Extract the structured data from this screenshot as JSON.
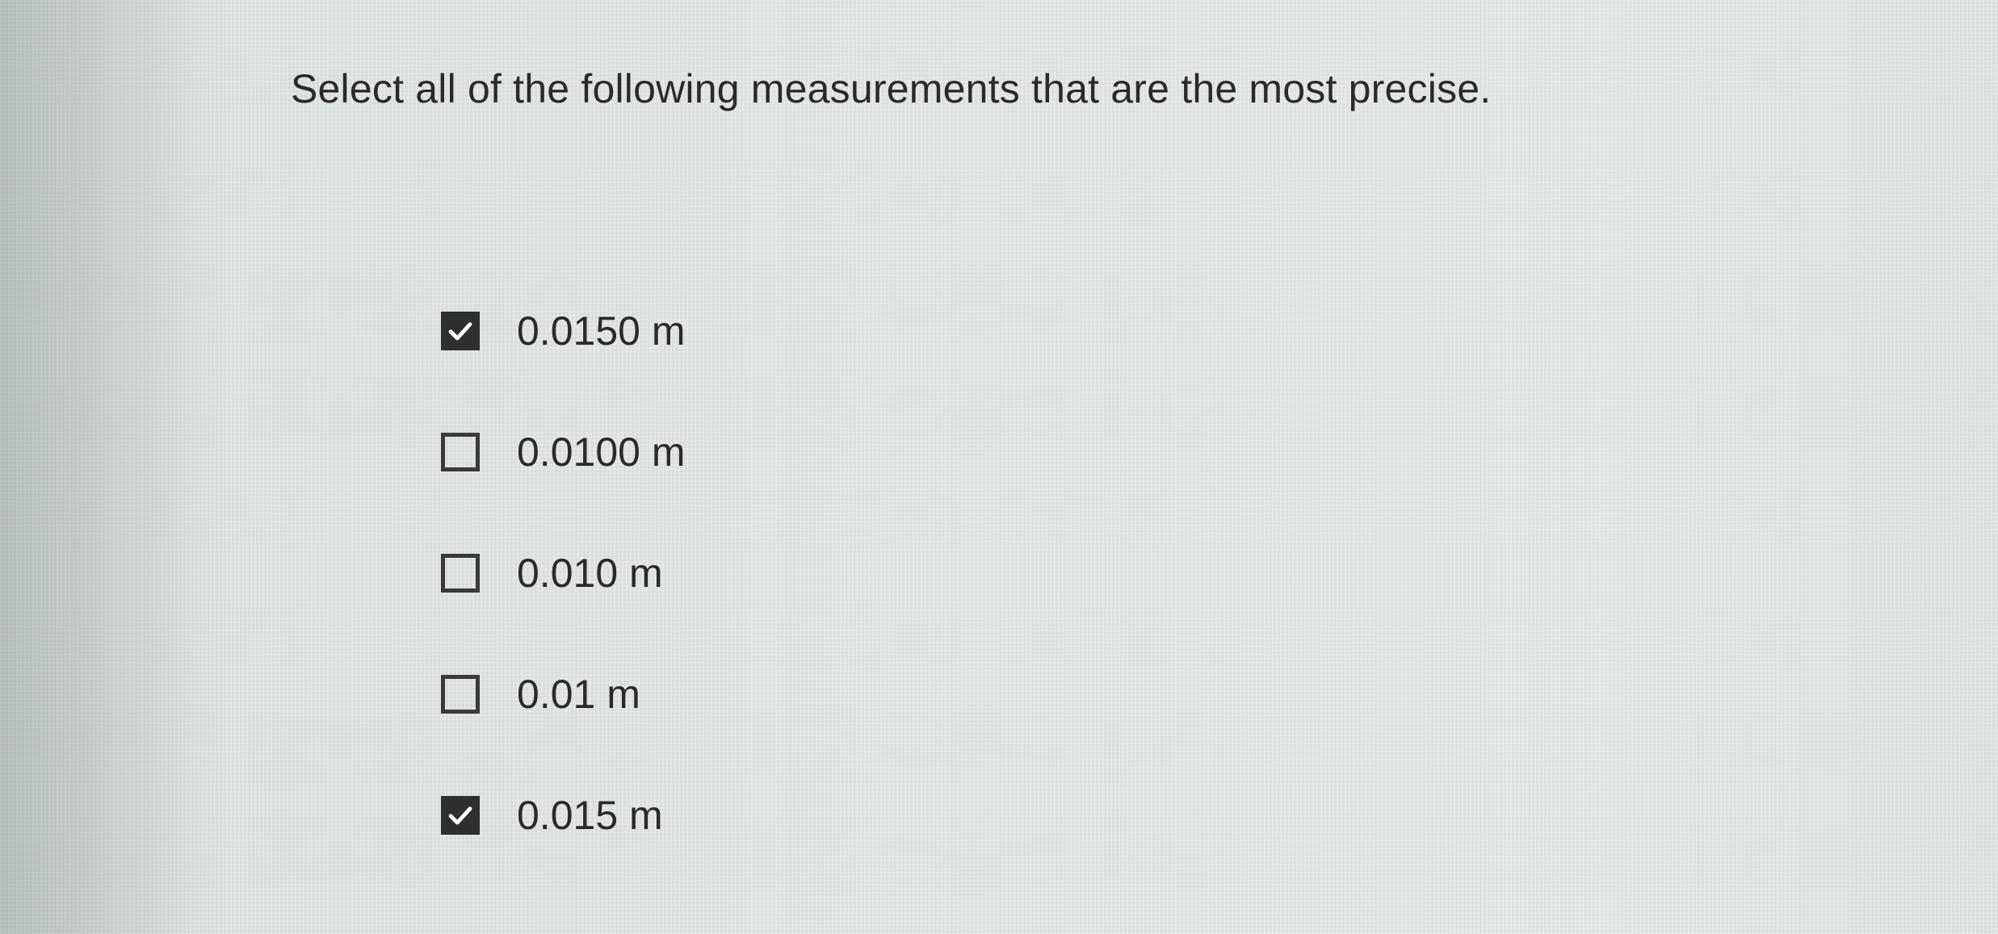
{
  "question": {
    "text": "Select all of the following measurements that are the most precise."
  },
  "options": [
    {
      "label": "0.0150 m",
      "checked": true
    },
    {
      "label": "0.0100 m",
      "checked": false
    },
    {
      "label": "0.010 m",
      "checked": false
    },
    {
      "label": "0.01 m",
      "checked": false
    },
    {
      "label": "0.015 m",
      "checked": true
    }
  ],
  "icons": {
    "checked": "checkmark-icon"
  },
  "colors": {
    "background": "#e4e8e8",
    "text": "#2a2a2a",
    "checkbox": "#2f2f2f"
  }
}
